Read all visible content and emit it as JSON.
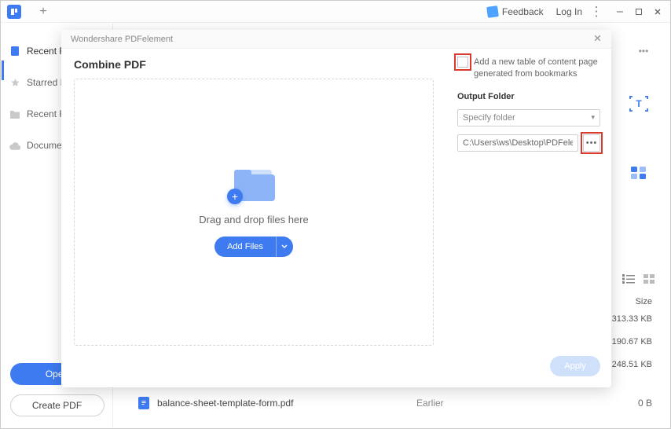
{
  "titlebar": {
    "feedback_label": "Feedback",
    "login_label": "Log In"
  },
  "sidebar": {
    "items": [
      {
        "id": "recent",
        "label": "Recent Files",
        "active": true
      },
      {
        "id": "starred",
        "label": "Starred Files",
        "active": false
      },
      {
        "id": "recent-folder",
        "label": "Recent Folder",
        "active": false
      },
      {
        "id": "document",
        "label": "Document",
        "active": false
      }
    ],
    "open_label": "Open",
    "create_label": "Create PDF"
  },
  "file_list": {
    "size_header": "Size",
    "rows": [
      {
        "size": "313.33 KB"
      },
      {
        "size": "190.67 KB"
      },
      {
        "size": "248.51 KB"
      }
    ],
    "visible_full_row": {
      "name": "balance-sheet-template-form.pdf",
      "date": "Earlier",
      "size": "0 B"
    }
  },
  "dialog": {
    "window_title": "Wondershare PDFelement",
    "heading": "Combine PDF",
    "drop_text": "Drag and drop files here",
    "add_files_label": "Add Files",
    "checkbox_label": "Add a new table of content page generated from bookmarks",
    "output_folder_label": "Output Folder",
    "specify_folder_placeholder": "Specify folder",
    "output_path": "C:\\Users\\ws\\Desktop\\PDFelement\\Com",
    "apply_label": "Apply"
  }
}
